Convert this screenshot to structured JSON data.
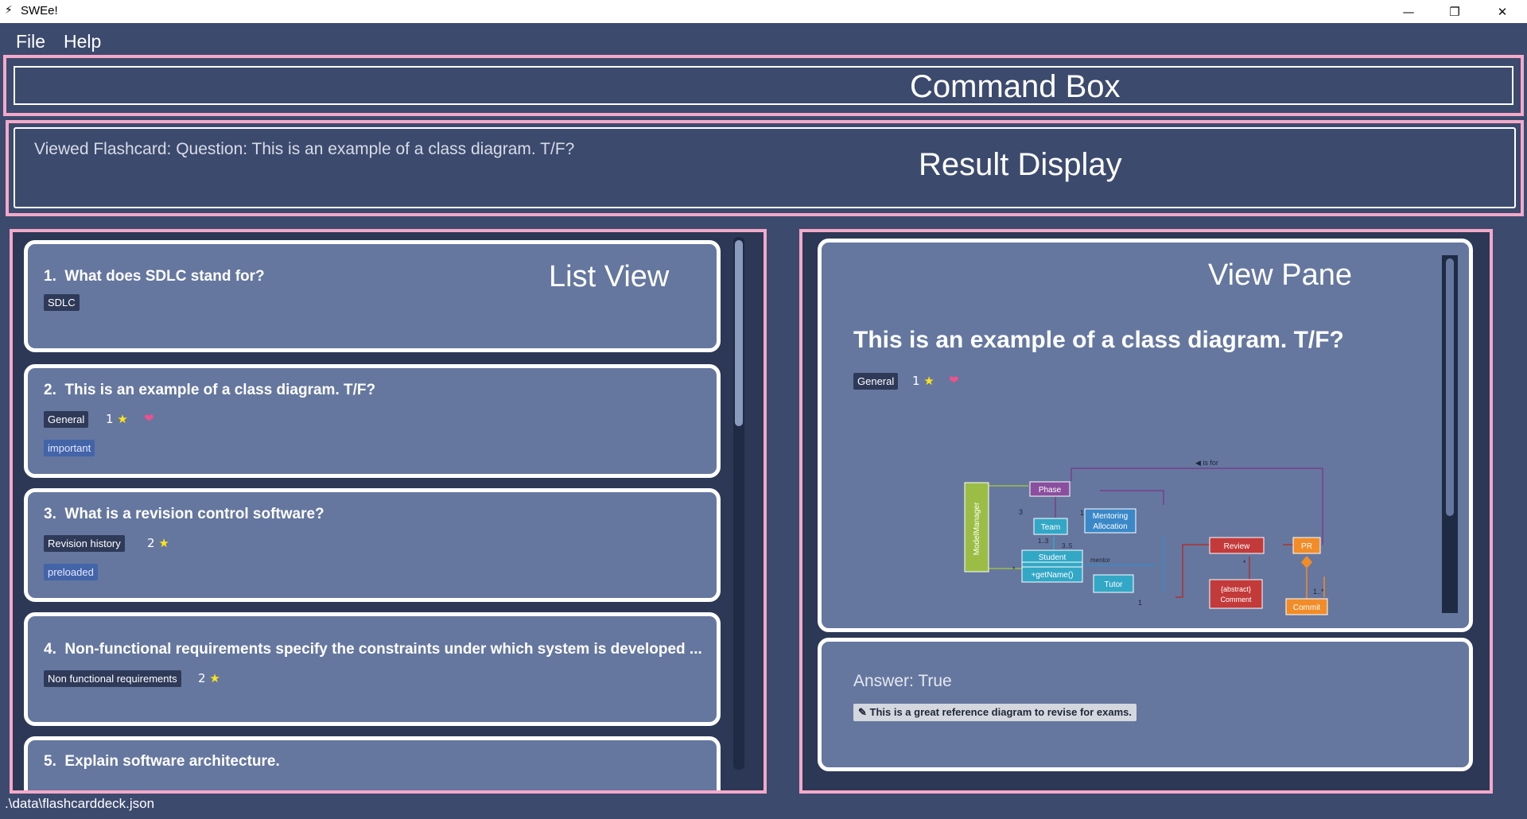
{
  "window": {
    "title": "SWEe!",
    "minimize_icon": "—",
    "maximize_icon": "❐",
    "close_icon": "✕"
  },
  "menu": {
    "file": "File",
    "help": "Help"
  },
  "command_box": {
    "value": "",
    "label": "Command Box"
  },
  "result_display": {
    "text": "Viewed Flashcard:  Question: This is an example of a class diagram. T/F?",
    "label": "Result Display"
  },
  "list_view": {
    "label": "List View",
    "cards": [
      {
        "index": "1.",
        "question": "What does SDLC stand for?",
        "tag": "SDLC"
      },
      {
        "index": "2.",
        "question": "This is an example of a class diagram. T/F?",
        "tag": "General",
        "rating": "1",
        "favourite": true,
        "subtag": "important"
      },
      {
        "index": "3.",
        "question": "What is a revision control software?",
        "tag": "Revision history",
        "rating": "2",
        "subtag": "preloaded"
      },
      {
        "index": "4.",
        "question": "Non-functional requirements specify the constraints under which system is developed ...",
        "tag": "Non functional requirements",
        "rating": "2"
      },
      {
        "index": "5.",
        "question": "Explain software architecture."
      }
    ]
  },
  "view_pane": {
    "label": "View Pane",
    "question": "This is an example of a class diagram. T/F?",
    "tag": "General",
    "rating": "1",
    "favourite": true,
    "answer": "Answer: True",
    "note": "✎ This is a great reference diagram to revise for exams.",
    "diagram": {
      "is_for": "◀ is for",
      "model_manager": "ModelManager",
      "phase": "Phase",
      "team": "Team",
      "mentoring": "Mentoring",
      "allocation": "Allocation",
      "student": "Student",
      "get_name": "+getName()",
      "tutor": "Tutor",
      "mentor": "mentor",
      "review": "Review",
      "abstract": "{abstract}",
      "comment": "Comment",
      "pr": "PR",
      "commit": "Commit",
      "m3": "3",
      "m1a": "1",
      "m13": "1..3",
      "m35": "3..5",
      "mstar": "*",
      "m1b": "1",
      "mstar2": "*",
      "m1star": "1..*"
    },
    "colors": {
      "phase": "#8a4f9e",
      "team": "#33a7c6",
      "mentoring": "#3a88c8",
      "model": "#9bbd45",
      "review": "#c33a3a",
      "pr": "#f28c28",
      "line_purple": "#7a3f8e",
      "line_red": "#b03030"
    }
  },
  "status_bar": {
    "path": ".\\data\\flashcarddeck.json"
  }
}
